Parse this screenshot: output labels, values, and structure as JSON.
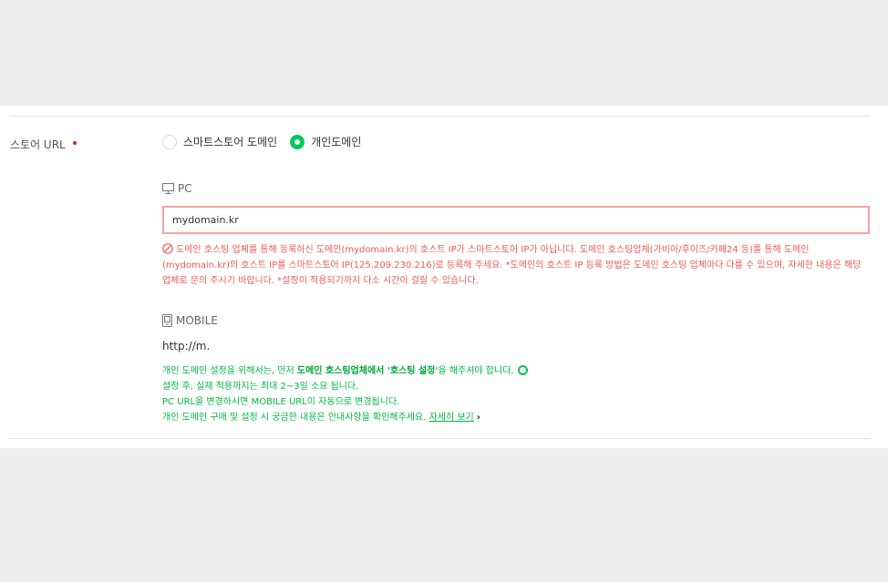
{
  "store_url": {
    "label": "스토어 URL",
    "options": [
      {
        "label": "스마트스토어 도메인",
        "selected": false
      },
      {
        "label": "개인도메인",
        "selected": true
      }
    ]
  },
  "pc": {
    "label": "PC",
    "input_value": "mydomain.kr",
    "error": "도메인 호스팅 업체를 통해 등록하신 도메인(mydomain.kr)의 호스트 IP가 스마트스토어 IP가 아닙니다. 도메인 호스팅업체(가비아/후이즈/카페24 등)를 통해 도메인(mydomain.kr)의 호스트 IP를 스마트스토어 IP(125.209.230.216)로 등록해 주세요. *도메인의 호스트 IP 등록 방법은 도메인 호스팅 업체마다 다를 수 있으며, 자세한 내용은 해당 업체로 문의 주시기 바랍니다. *설정이 적용되기까지 다소 시간이 걸릴 수 있습니다."
  },
  "mobile": {
    "label": "MOBILE",
    "url": "http://m."
  },
  "notice": {
    "line1_prefix": "개인 도메인 설정을 위해서는, 먼저 ",
    "line1_bold": "도메인 호스팅업체에서 '호스팅 설정'",
    "line1_suffix": "을 해주셔야 합니다.",
    "line2": "설정 후, 실제 적용까지는 최대 2~3일 소요 됩니다.",
    "line3": "PC URL을 변경하시면 MOBILE URL이 자동으로 변경됩니다.",
    "line4_prefix": "개인 도메인 구매 및 설정 시 궁금한 내용은 안내사항을 확인해주세요.",
    "line4_link": "자세히 보기",
    "line4_chevron": "›"
  },
  "colors": {
    "accent_green": "#03c75a",
    "error_red": "#f05a5a",
    "error_border": "#f2a3a3",
    "required_dot": "#e02020"
  },
  "icons": [
    "monitor-icon",
    "mobile-phone-icon",
    "error-prohibited-icon",
    "loading-circle-icon",
    "chevron-right-icon"
  ]
}
